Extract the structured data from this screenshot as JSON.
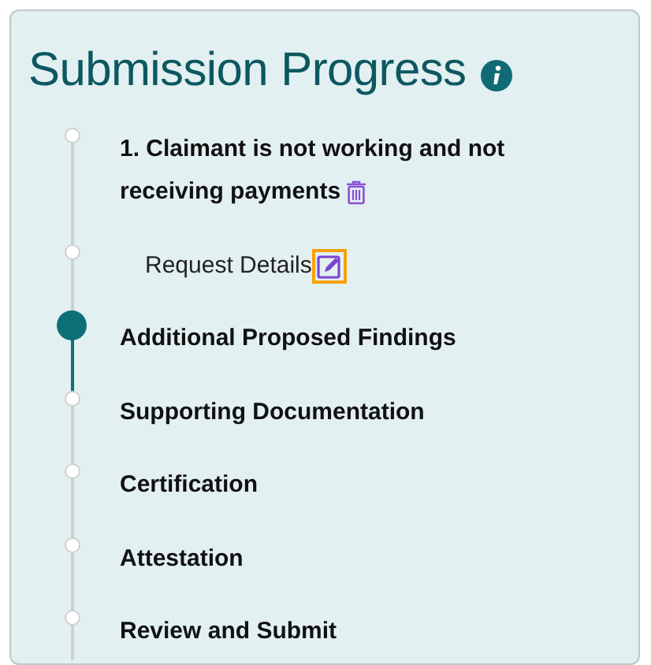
{
  "title": "Submission Progress",
  "steps": [
    {
      "label": "1. Claimant is not working and not receiving payments",
      "kind": "step",
      "selected": false,
      "action": {
        "kind": "delete",
        "focused": false
      }
    },
    {
      "label": "Request Details",
      "kind": "substep",
      "selected": false,
      "action": {
        "kind": "edit",
        "focused": true
      }
    },
    {
      "label": "Additional Proposed Findings",
      "kind": "step",
      "selected": true
    },
    {
      "label": "Supporting Documentation",
      "kind": "step",
      "selected": false
    },
    {
      "label": "Certification",
      "kind": "step",
      "selected": false
    },
    {
      "label": "Attestation",
      "kind": "step",
      "selected": false
    },
    {
      "label": "Review and Submit",
      "kind": "step",
      "selected": false
    }
  ]
}
